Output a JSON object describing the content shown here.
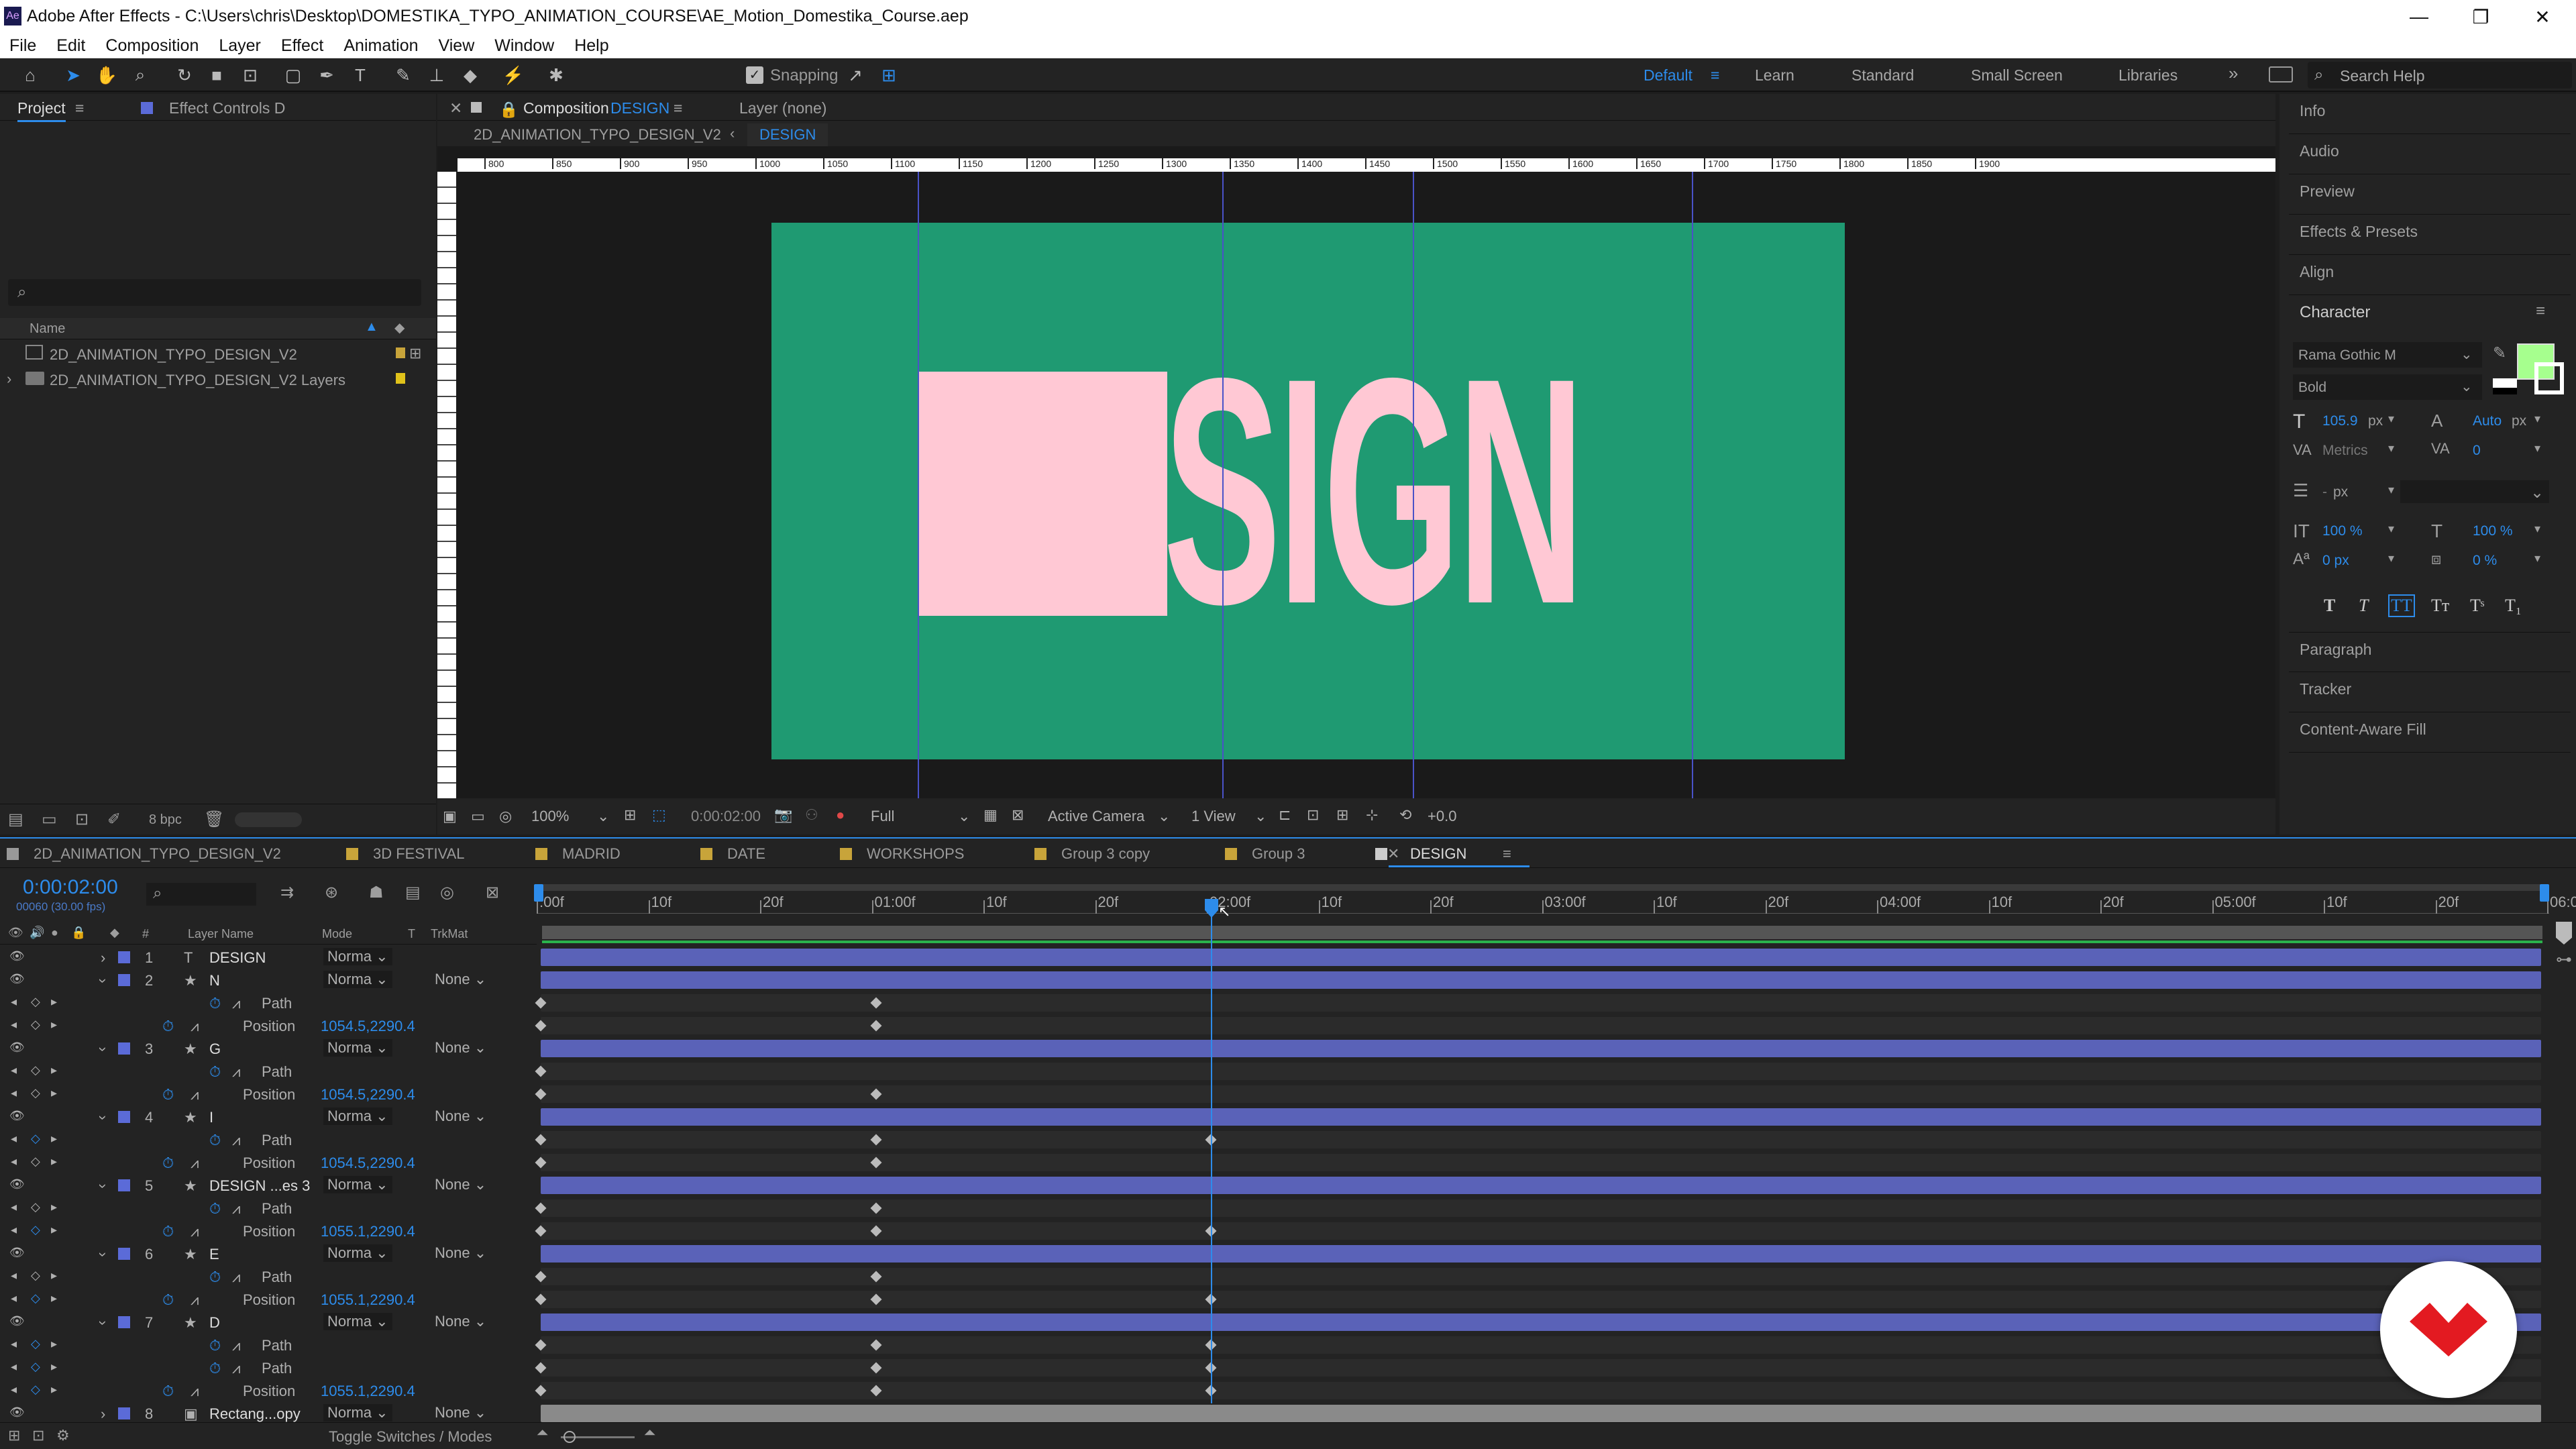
{
  "window": {
    "title": "Adobe After Effects - C:\\Users\\chris\\Desktop\\DOMESTIKA_TYPO_ANIMATION_COURSE\\AE_Motion_Domestika_Course.aep"
  },
  "menu": [
    "File",
    "Edit",
    "Composition",
    "Layer",
    "Effect",
    "Animation",
    "View",
    "Window",
    "Help"
  ],
  "toolbar": {
    "snapping_label": "Snapping",
    "workspaces": [
      "Default",
      "Learn",
      "Standard",
      "Small Screen",
      "Libraries"
    ],
    "active_workspace": "Default",
    "search_placeholder": "Search Help"
  },
  "project": {
    "tab_project": "Project",
    "tab_effects": "Effect Controls D",
    "col_name": "Name",
    "items": [
      "2D_ANIMATION_TYPO_DESIGN_V2",
      "2D_ANIMATION_TYPO_DESIGN_V2 Layers"
    ],
    "bpc": "8 bpc"
  },
  "composition": {
    "tab_label": "Composition",
    "tab_name": "DESIGN",
    "layer_tab": "Layer (none)",
    "breadcrumb_parent": "2D_ANIMATION_TYPO_DESIGN_V2",
    "breadcrumb_current": "DESIGN",
    "canvas_text": "DESIGN",
    "bg_color": "#1f9a72",
    "text_color": "#ffc8d4",
    "ruler_ticks": [
      "800",
      "850",
      "900",
      "950",
      "1000",
      "1050",
      "1100",
      "1150",
      "1200",
      "1250",
      "1300",
      "1350",
      "1400",
      "1450",
      "1500",
      "1550",
      "1600",
      "1650",
      "1700",
      "1750",
      "1800",
      "1850",
      "1900"
    ]
  },
  "viewer": {
    "zoom": "100%",
    "timecode": "0:00:02:00",
    "resolution": "Full",
    "camera": "Active Camera",
    "views": "1 View",
    "exposure": "+0.0"
  },
  "right_panels": {
    "items": [
      "Info",
      "Audio",
      "Preview",
      "Effects & Presets",
      "Align"
    ],
    "character": "Character",
    "font": "Rama Gothic M",
    "style": "Bold",
    "size": "105.9",
    "size_unit": "px",
    "leading": "Auto",
    "kerning": "Metrics",
    "tracking": "0",
    "stroke_unit": "px",
    "vscale": "100 %",
    "hscale": "100 %",
    "baseline": "0 px",
    "tsume": "0 %",
    "fill_color": "#a6ff8e",
    "bottom": [
      "Paragraph",
      "Tracker",
      "Content-Aware Fill"
    ]
  },
  "timeline": {
    "tabs": [
      "2D_ANIMATION_TYPO_DESIGN_V2",
      "3D FESTIVAL",
      "MADRID",
      "DATE",
      "WORKSHOPS",
      "Group 3 copy",
      "Group 3",
      "DESIGN"
    ],
    "active_tab": "DESIGN",
    "timecode": "0:00:02:00",
    "fps": "00060 (30.00 fps)",
    "col_layer_name": "Layer Name",
    "col_mode": "Mode",
    "col_t": "T",
    "col_trkmat": "TrkMat",
    "ruler": [
      ":00f",
      "10f",
      "20f",
      "01:00f",
      "10f",
      "20f",
      "02:00f",
      "10f",
      "20f",
      "03:00f",
      "10f",
      "20f",
      "04:00f",
      "10f",
      "20f",
      "05:00f",
      "10f",
      "20f",
      "06:0"
    ],
    "rows": [
      {
        "num": "1",
        "icon": "T",
        "name": "DESIGN",
        "mode": "Norma",
        "trk": "",
        "type": "layer"
      },
      {
        "num": "2",
        "icon": "★",
        "name": "N",
        "mode": "Norma",
        "trk": "None",
        "type": "layer"
      },
      {
        "name": "Path",
        "type": "prop"
      },
      {
        "name": "Position",
        "value": "1054.5,2290.4",
        "type": "prop"
      },
      {
        "num": "3",
        "icon": "★",
        "name": "G",
        "mode": "Norma",
        "trk": "None",
        "type": "layer"
      },
      {
        "name": "Path",
        "type": "prop"
      },
      {
        "name": "Position",
        "value": "1054.5,2290.4",
        "type": "prop"
      },
      {
        "num": "4",
        "icon": "★",
        "name": "I",
        "mode": "Norma",
        "trk": "None",
        "type": "layer"
      },
      {
        "name": "Path",
        "type": "prop"
      },
      {
        "name": "Position",
        "value": "1054.5,2290.4",
        "type": "prop"
      },
      {
        "num": "5",
        "icon": "★",
        "name": "DESIGN ...es 3",
        "mode": "Norma",
        "trk": "None",
        "type": "layer"
      },
      {
        "name": "Path",
        "type": "prop"
      },
      {
        "name": "Position",
        "value": "1055.1,2290.4",
        "type": "prop"
      },
      {
        "num": "6",
        "icon": "★",
        "name": "E",
        "mode": "Norma",
        "trk": "None",
        "type": "layer"
      },
      {
        "name": "Path",
        "type": "prop"
      },
      {
        "name": "Position",
        "value": "1055.1,2290.4",
        "type": "prop"
      },
      {
        "num": "7",
        "icon": "★",
        "name": "D",
        "mode": "Norma",
        "trk": "None",
        "type": "layer"
      },
      {
        "name": "Path",
        "type": "prop"
      },
      {
        "name": "Path",
        "type": "prop"
      },
      {
        "name": "Position",
        "value": "1055.1,2290.4",
        "type": "prop"
      },
      {
        "num": "8",
        "icon": "▣",
        "name": "Rectang...opy",
        "mode": "Norma",
        "trk": "None",
        "type": "layer"
      }
    ],
    "toggle_label": "Toggle Switches / Modes"
  }
}
